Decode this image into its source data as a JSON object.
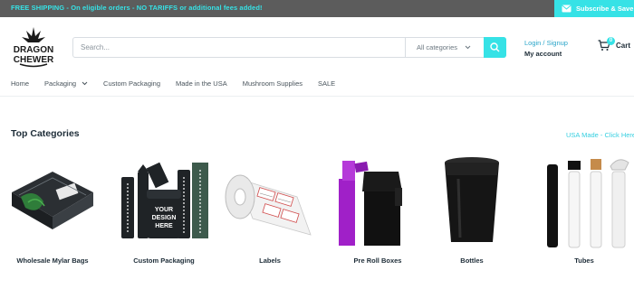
{
  "topbar": {
    "promo": "FREE SHIPPING - On eligible orders - NO TARIFFS or additional fees added!",
    "subscribe": "Subscribe & Save"
  },
  "logo": {
    "line1": "DRAGON",
    "line2": "CHEWER"
  },
  "search": {
    "placeholder": "Search...",
    "category": "All categories"
  },
  "account": {
    "login": "Login / Signup",
    "my_account": "My account"
  },
  "cart": {
    "label": "Cart",
    "count": "0"
  },
  "nav": [
    {
      "label": "Home"
    },
    {
      "label": "Packaging"
    },
    {
      "label": "Custom Packaging"
    },
    {
      "label": "Made in the USA"
    },
    {
      "label": "Mushroom Supplies"
    },
    {
      "label": "SALE"
    }
  ],
  "section": {
    "title": "Top Categories",
    "link": "USA Made - Click Here"
  },
  "categories": [
    {
      "name": "Wholesale Mylar Bags",
      "image": "mylar-bag"
    },
    {
      "name": "Custom Packaging",
      "image": "custom-packaging",
      "art_text": [
        "YOUR",
        "DESIGN",
        "HERE"
      ]
    },
    {
      "name": "Labels",
      "image": "label-roll"
    },
    {
      "name": "Pre Roll Boxes",
      "image": "pre-roll-boxes"
    },
    {
      "name": "Bottles",
      "image": "pop-top-bottle"
    },
    {
      "name": "Tubes",
      "image": "pre-roll-tubes"
    }
  ],
  "colors": {
    "accent": "#36e2e6",
    "topbar": "#5c5c5c",
    "text": "#1e2d38"
  }
}
